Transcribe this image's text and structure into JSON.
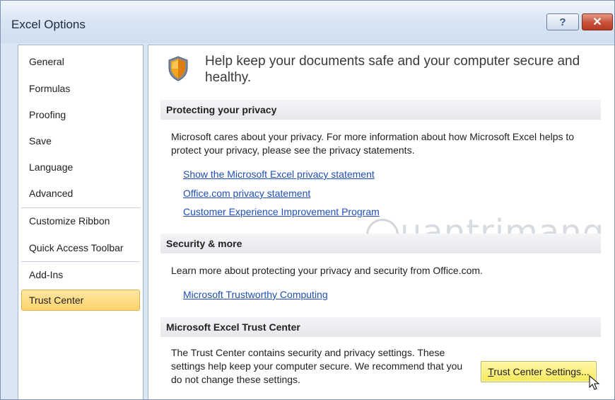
{
  "window": {
    "title": "Excel Options",
    "help_glyph": "?",
    "close_glyph": "✕"
  },
  "nav": {
    "items": [
      {
        "label": "General"
      },
      {
        "label": "Formulas"
      },
      {
        "label": "Proofing"
      },
      {
        "label": "Save"
      },
      {
        "label": "Language"
      },
      {
        "label": "Advanced"
      },
      {
        "label": "Customize Ribbon"
      },
      {
        "label": "Quick Access Toolbar"
      },
      {
        "label": "Add-Ins"
      },
      {
        "label": "Trust Center",
        "selected": true
      }
    ]
  },
  "content": {
    "headline": "Help keep your documents safe and your computer secure and healthy.",
    "privacy": {
      "heading": "Protecting your privacy",
      "text": "Microsoft cares about your privacy. For more information about how Microsoft Excel helps to protect your privacy, please see the privacy statements.",
      "links": [
        "Show the Microsoft Excel privacy statement",
        "Office.com privacy statement",
        "Customer Experience Improvement Program"
      ]
    },
    "security": {
      "heading": "Security & more",
      "text": "Learn more about protecting your privacy and security from Office.com.",
      "links": [
        "Microsoft Trustworthy Computing"
      ]
    },
    "trust_center": {
      "heading": "Microsoft Excel Trust Center",
      "text": "The Trust Center contains security and privacy settings. These settings help keep your computer secure. We recommend that you do not change these settings.",
      "button_label": "Trust Center Settings...",
      "button_access_key": "T",
      "button_rest": "rust Center Settings..."
    },
    "watermark": "uantrimang"
  },
  "colors": {
    "link": "#1f4fb4",
    "selected_nav": "#ffd36b",
    "button": "#f7e85a",
    "close": "#c7513a"
  },
  "icons": {
    "shield": "shield-icon",
    "help": "help-icon",
    "close": "close-icon",
    "cursor": "mouse-pointer-icon"
  }
}
